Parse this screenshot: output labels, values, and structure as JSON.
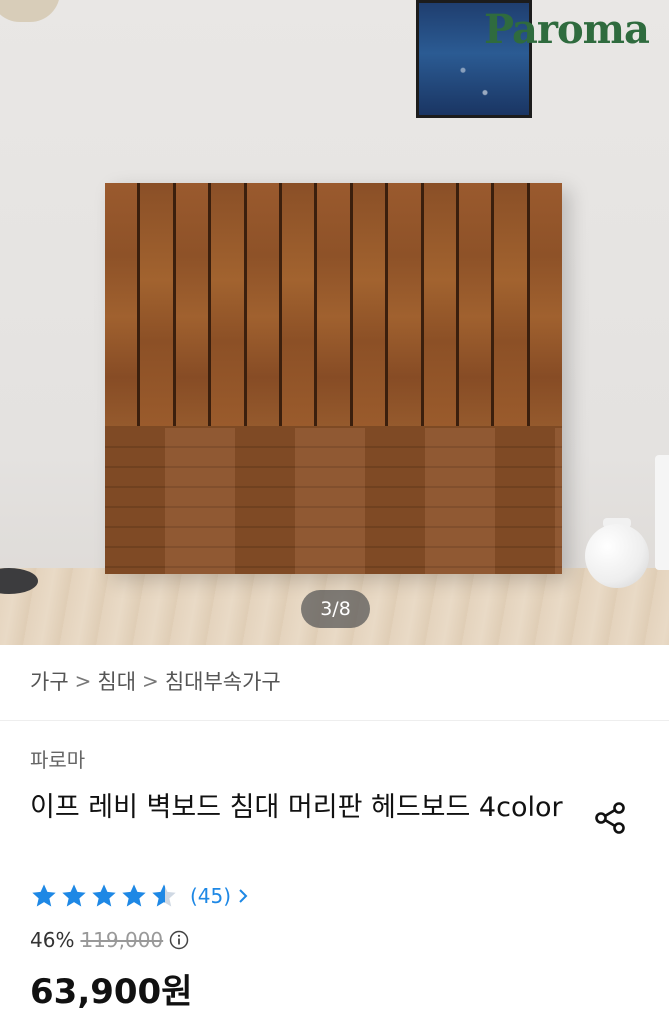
{
  "hero": {
    "logo_text": "Paroma",
    "image_counter": "3/8"
  },
  "breadcrumb": {
    "items": [
      "가구",
      "침대",
      "침대부속가구"
    ],
    "separator": ">"
  },
  "product": {
    "brand": "파로마",
    "title": "이프 레비 벽보드 침대 머리판 헤드보드 4color",
    "rating": 4.5,
    "review_count": "(45)",
    "discount": "46%",
    "original_price": "119,000",
    "final_price": "63,900원"
  },
  "colors": {
    "star": "#1e88e5",
    "review_link": "#1e88e5",
    "text": "#111111",
    "muted": "#999999"
  },
  "icons": {
    "share": "share-icon",
    "star": "star-icon",
    "chevron": "chevron-right-icon",
    "info": "info-icon"
  }
}
